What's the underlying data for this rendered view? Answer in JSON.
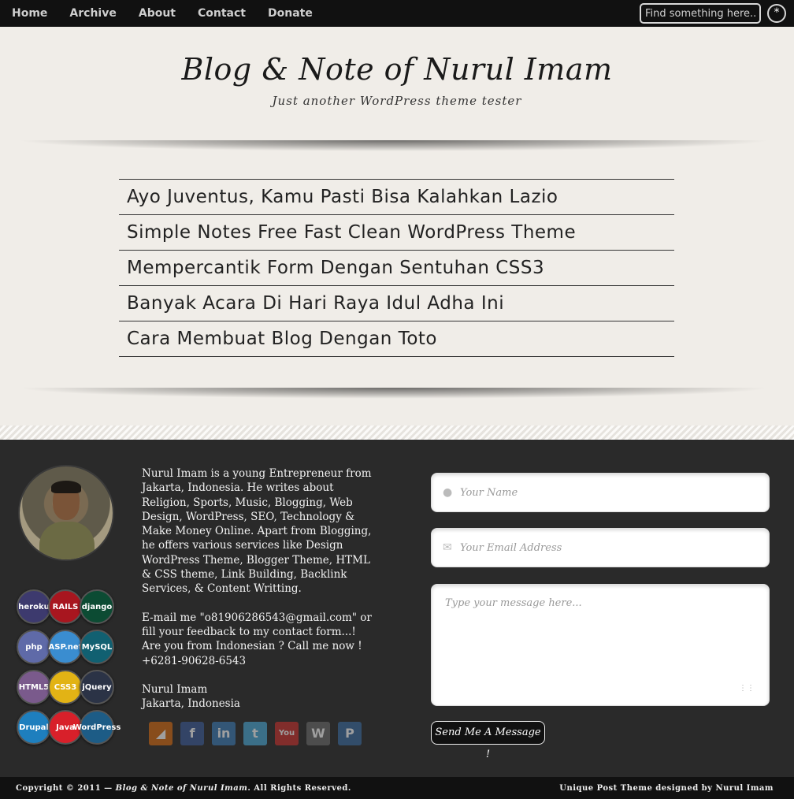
{
  "nav": {
    "items": [
      "Home",
      "Archive",
      "About",
      "Contact",
      "Donate"
    ],
    "search_placeholder": "Find something here...",
    "search_button": "*"
  },
  "header": {
    "title": "Blog & Note of Nurul Imam",
    "tagline": "Just another WordPress theme tester"
  },
  "posts": [
    "Ayo Juventus, Kamu Pasti Bisa Kalahkan Lazio",
    "Simple Notes Free Fast Clean WordPress Theme",
    "Mempercantik Form Dengan Sentuhan CSS3",
    "Banyak Acara Di Hari Raya Idul Adha Ini",
    "Cara Membuat Blog Dengan Toto"
  ],
  "about": {
    "bio": "Nurul Imam is a young Entrepreneur from Jakarta, Indonesia. He writes about Religion, Sports, Music, Blogging, Web Design, WordPress, SEO, Technology & Make Money Online. Apart from Blogging, he offers various services like Design WordPress Theme, Blogger Theme, HTML & CSS theme, Link Building, Backlink Services, & Content Writting.",
    "contact": "E-mail me \"o81906286543@gmail.com\" or fill your feedback to my contact form...! Are you from Indonesian ? Call me now ! +6281-90628-6543",
    "name": "Nurul Imam",
    "location": "Jakarta, Indonesia"
  },
  "badges": [
    {
      "label": "heroku",
      "color": "#3d3a6e"
    },
    {
      "label": "RAILS",
      "color": "#a8161f"
    },
    {
      "label": "django",
      "color": "#0c4b33"
    },
    {
      "label": "php",
      "color": "#5f6aa8"
    },
    {
      "label": "ASP.net",
      "color": "#3a8dd0"
    },
    {
      "label": "MySQL",
      "color": "#116071"
    },
    {
      "label": "HTML5",
      "color": "#7a5a8c"
    },
    {
      "label": "CSS3",
      "color": "#e2b315"
    },
    {
      "label": "jQuery",
      "color": "#2b3346"
    },
    {
      "label": "Drupal",
      "color": "#1e7fbe"
    },
    {
      "label": "Java",
      "color": "#d8202a"
    },
    {
      "label": "WordPress",
      "color": "#1d5c86"
    }
  ],
  "social": [
    {
      "icon": "rss-icon",
      "glyph": "◢",
      "color": "#d66a12"
    },
    {
      "icon": "facebook-icon",
      "glyph": "f",
      "color": "#3b5b98"
    },
    {
      "icon": "linkedin-icon",
      "glyph": "in",
      "color": "#3b7bb5"
    },
    {
      "icon": "twitter-icon",
      "glyph": "t",
      "color": "#49a9d6"
    },
    {
      "icon": "youtube-icon",
      "glyph": "You",
      "color": "#c9302c"
    },
    {
      "icon": "wordpress-icon",
      "glyph": "W",
      "color": "#6b6b6b"
    },
    {
      "icon": "paypal-icon",
      "glyph": "P",
      "color": "#3a6aa0"
    }
  ],
  "form": {
    "name_placeholder": "Your Name",
    "email_placeholder": "Your Email Address",
    "message_placeholder": "Type your message here...",
    "send_label": "Send Me A Message !"
  },
  "footer": {
    "copyright_prefix": "Copyright © 2011 — ",
    "copyright_site": "Blog & Note of Nurul Imam",
    "copyright_suffix": ". All Rights Reserved.",
    "credit": "Unique Post Theme designed by Nurul Imam"
  }
}
